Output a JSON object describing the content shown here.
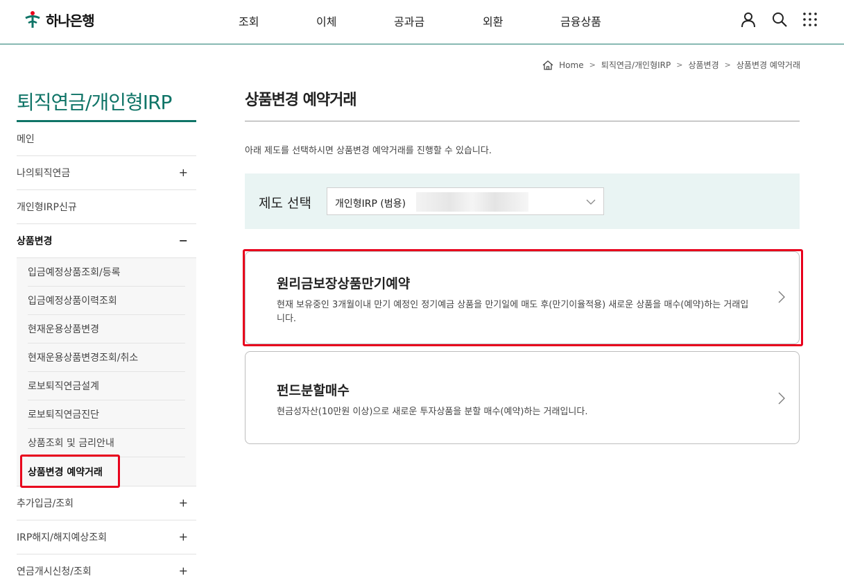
{
  "header": {
    "logo_text": "하나은행",
    "brand_color": "#0f7467",
    "nav": [
      "조회",
      "이체",
      "공과금",
      "외환",
      "금융상품"
    ],
    "icons": [
      "user-icon",
      "search-icon",
      "all-menu-icon"
    ]
  },
  "breadcrumb": {
    "items": [
      "Home",
      "퇴직연금/개인형IRP",
      "상품변경",
      "상품변경 예약거래"
    ]
  },
  "sidebar": {
    "title": "퇴직연금/개인형IRP",
    "items": [
      {
        "label": "메인",
        "toggle": ""
      },
      {
        "label": "나의퇴직연금",
        "toggle": "+"
      },
      {
        "label": "개인형IRP신규",
        "toggle": ""
      },
      {
        "label": "상품변경",
        "toggle": "−"
      },
      {
        "label": "추가입금/조회",
        "toggle": "+"
      },
      {
        "label": "IRP해지/해지예상조회",
        "toggle": "+"
      },
      {
        "label": "연금개시신청/조회",
        "toggle": "+"
      }
    ],
    "sub_items": [
      "입금예정상품조회/등록",
      "입금예정상품이력조회",
      "현재운용상품변경",
      "현재운용상품변경조회/취소",
      "로보퇴직연금설계",
      "로보퇴직연금진단",
      "상품조회 및 금리안내",
      "상품변경 예약거래"
    ]
  },
  "main": {
    "title": "상품변경 예약거래",
    "description": "아래 제도를 선택하시면 상품변경 예약거래를 진행할 수 있습니다.",
    "select": {
      "label": "제도 선택",
      "value": "개인형IRP (범용)"
    },
    "cards": [
      {
        "title": "원리금보장상품만기예약",
        "desc": "현재 보유중인 3개월이내 만기 예정인 정기예금 상품을 만기일에 매도 후(만기이율적용) 새로운 상품을 매수(예약)하는 거래입니다."
      },
      {
        "title": "펀드분할매수",
        "desc": "현금성자산(10만원 이상)으로 새로운 투자상품을 분할 매수(예약)하는 거래입니다."
      }
    ]
  },
  "highlight_color": "#e8001c"
}
